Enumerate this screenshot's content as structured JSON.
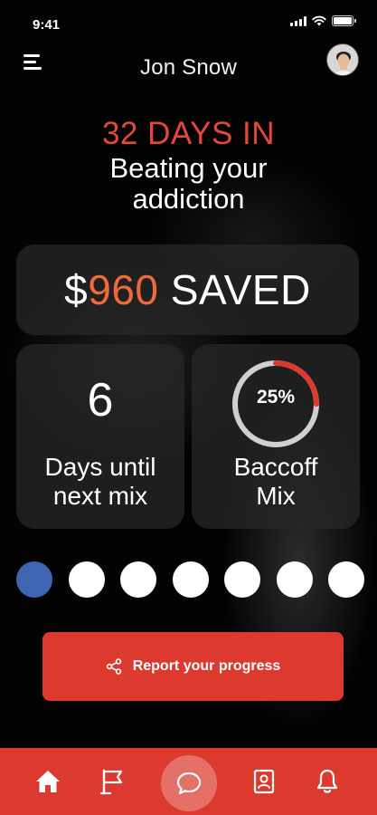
{
  "status_bar": {
    "time": "9:41"
  },
  "header": {
    "user_name": "Jon Snow",
    "menu_icon": "hamburger-menu-icon",
    "avatar_icon": "user-avatar"
  },
  "hero": {
    "days_in": "32 DAYS IN",
    "tagline_line1": "Beating your",
    "tagline_line2": "addiction"
  },
  "savings": {
    "currency": "$",
    "amount": "960",
    "label": "SAVED"
  },
  "days_card": {
    "number": "6",
    "caption_line1": "Days until",
    "caption_line2": "next mix"
  },
  "mix_card": {
    "percent_label": "25%",
    "progress": 0.25,
    "caption_line1": "Baccoff",
    "caption_line2": "Mix"
  },
  "week_dots": {
    "count": 7,
    "active_index": 0,
    "active_color": "#3e66b0",
    "inactive_color": "#ffffff"
  },
  "report_button": {
    "label": "Report your progress",
    "icon": "share-icon"
  },
  "tab_bar": {
    "tabs": [
      {
        "name": "home",
        "icon": "home-icon"
      },
      {
        "name": "goals",
        "icon": "flag-icon"
      },
      {
        "name": "chat",
        "icon": "chat-bubble-icon"
      },
      {
        "name": "contacts",
        "icon": "contact-card-icon"
      },
      {
        "name": "notifications",
        "icon": "bell-icon"
      }
    ]
  },
  "colors": {
    "accent_red": "#dc3a2f",
    "headline_red": "#e5473a",
    "amount_orange": "#ef6a3a",
    "ring_track": "#cfcfcf"
  }
}
